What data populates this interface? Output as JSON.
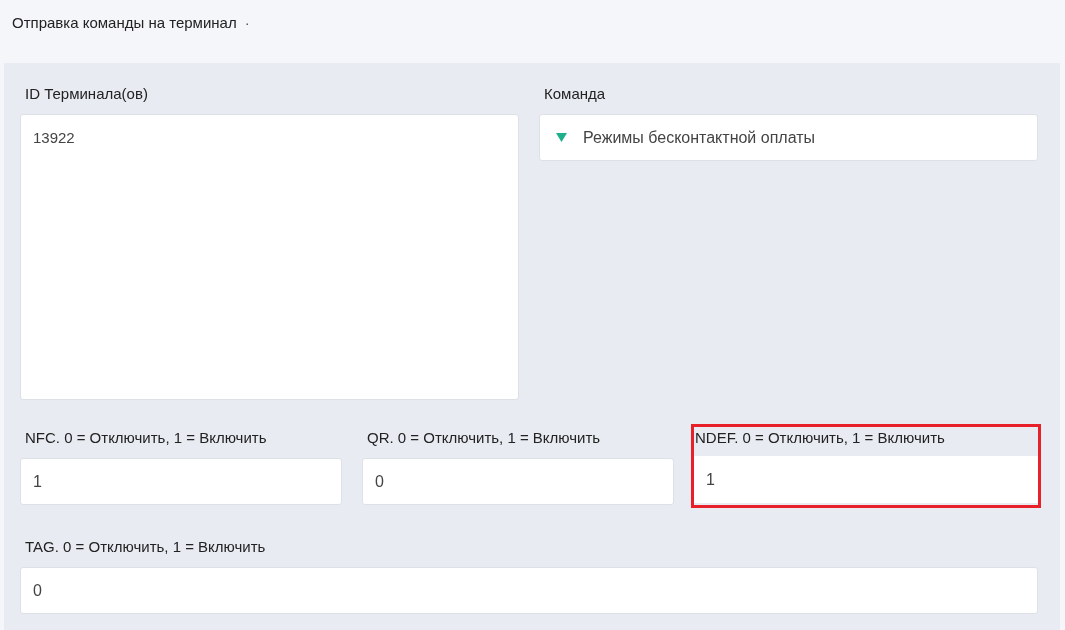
{
  "header": {
    "title": "Отправка команды на терминал",
    "marker": "·"
  },
  "terminal_ids": {
    "label": "ID Терминала(ов)",
    "value": "13922"
  },
  "command": {
    "label": "Команда",
    "value": "Режимы бесконтактной оплаты"
  },
  "params": [
    {
      "label": "NFC. 0 = Отключить, 1 = Включить",
      "value": "1",
      "highlighted": false
    },
    {
      "label": "QR. 0 = Отключить, 1 = Включить",
      "value": "0",
      "highlighted": false
    },
    {
      "label": "NDEF. 0 = Отключить, 1 = Включить",
      "value": "1",
      "highlighted": true
    },
    {
      "label": "TAG. 0 = Отключить, 1 = Включить",
      "value": "0",
      "highlighted": false
    }
  ]
}
